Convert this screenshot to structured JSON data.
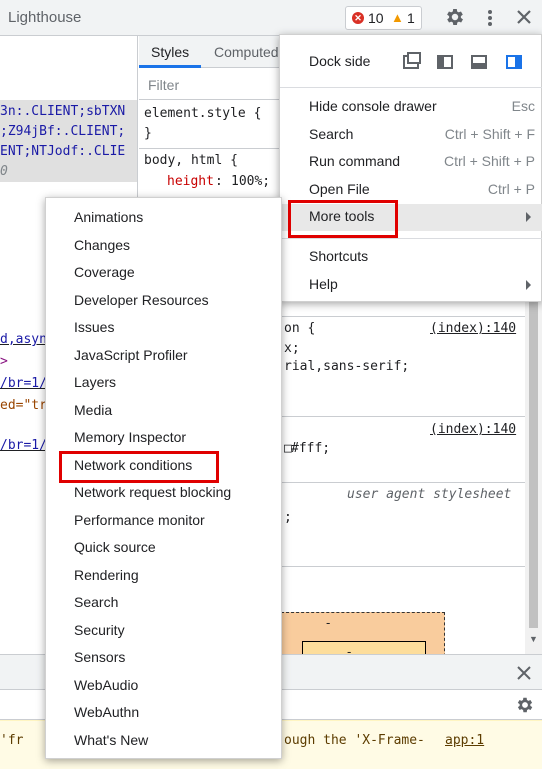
{
  "topbar": {
    "tab_title": "Lighthouse",
    "error_count": "10",
    "warning_count": "1"
  },
  "code_pane": {
    "lines": [
      {
        "text": "3n:.CLIENT;sbTXN",
        "color": "#1a1aa6"
      },
      {
        "text": ";Z94jBf:.CLIENT;",
        "color": "#1a1aa6"
      },
      {
        "text": "ENT;NTJodf:.CLIE",
        "color": "#1a1aa6"
      },
      {
        "text": "0",
        "color": "#80868b"
      },
      {
        "text": "d,asyn",
        "color": "#1a1aa6"
      },
      {
        "text": ">",
        "color": "#881280"
      },
      {
        "text": "/br=1/",
        "color": "#1a1aa6"
      },
      {
        "text": "ed=\"tr",
        "color": "#994500"
      },
      {
        "text": "/br=1/",
        "color": "#1a1aa6"
      }
    ]
  },
  "styles": {
    "tab_styles": "Styles",
    "tab_computed": "Computed",
    "filter_placeholder": "Filter",
    "element_style_selector": "element.style {",
    "element_style_close": "}",
    "body_selector": "body, html {",
    "height_prop": "height",
    "height_value": "100%;",
    "rule2_selector_tail": "on {",
    "rule2_link": "(index):140",
    "rule2_line2": "x;",
    "rule2_line3": "rial,sans-serif;",
    "rule3_link": "(index):140",
    "rule3_line2": "#fff;",
    "ua_label": "user agent stylesheet",
    "ua_line": ";",
    "box_dash1": "-",
    "box_dash2": "-"
  },
  "main_menu": {
    "dock_side_label": "Dock side",
    "items": [
      {
        "label": "Hide console drawer",
        "shortcut": "Esc"
      },
      {
        "label": "Search",
        "shortcut": "Ctrl + Shift + F"
      },
      {
        "label": "Run command",
        "shortcut": "Ctrl + Shift + P"
      },
      {
        "label": "Open File",
        "shortcut": "Ctrl + P"
      },
      {
        "label": "More tools",
        "shortcut": ""
      }
    ],
    "items2": [
      {
        "label": "Shortcuts"
      },
      {
        "label": "Help"
      }
    ]
  },
  "sub_menu": {
    "items": [
      "Animations",
      "Changes",
      "Coverage",
      "Developer Resources",
      "Issues",
      "JavaScript Profiler",
      "Layers",
      "Media",
      "Memory Inspector",
      "Network conditions",
      "Network request blocking",
      "Performance monitor",
      "Quick source",
      "Rendering",
      "Search",
      "Security",
      "Sensors",
      "WebAudio",
      "WebAuthn",
      "What's New"
    ]
  },
  "console": {
    "message": "'fr",
    "message_tail": "ough the 'X-Frame-",
    "link": "app:1"
  },
  "colors": {
    "highlight_red": "#e00000",
    "accent_blue": "#1a73e8",
    "error_red": "#d93025",
    "warning_amber": "#f29900"
  }
}
